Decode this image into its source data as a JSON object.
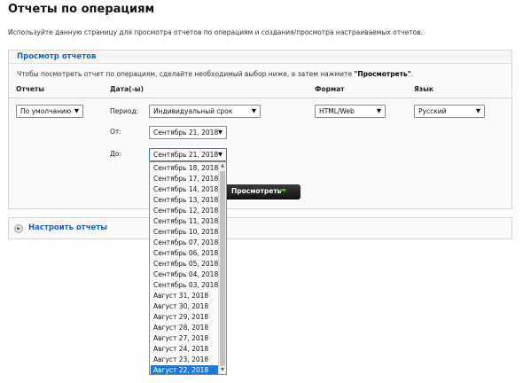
{
  "page": {
    "title": "Отчеты по операциям",
    "description": "Используйте данную страницу для просмотра отчетов по операциям и создания/просмотра настраиваемых отчетов."
  },
  "viewer": {
    "title": "Просмотр отчетов",
    "instruction_prefix": "Чтобы посмотреть отчет по операциям, сделайте необходимый выбор ниже, а затем нажмите ",
    "instruction_action": "\"Просмотреть\"",
    "instruction_suffix": ".",
    "columns": {
      "reports": "Отчеты",
      "date": "Дата(-ы)",
      "format": "Формат",
      "language": "Язык"
    },
    "report_select": "По умолчанию",
    "period_label": "Период:",
    "period_select": "Индивидуальный срок",
    "from_label": "От:",
    "from_select": "Сентябрь 21, 2018",
    "to_label": "До:",
    "to_select": "Сентябрь 21, 2018",
    "format_select": "HTML/Web",
    "language_select": "Русский",
    "submit_label": "Просмотреть",
    "submit_icon": "arrow-right-icon"
  },
  "to_dropdown": {
    "options": [
      "Сентябрь 18, 2018",
      "Сентябрь 17, 2018",
      "Сентябрь 14, 2018",
      "Сентябрь 13, 2018",
      "Сентябрь 12, 2018",
      "Сентябрь 11, 2018",
      "Сентябрь 10, 2018",
      "Сентябрь 07, 2018",
      "Сентябрь 06, 2018",
      "Сентябрь 05, 2018",
      "Сентябрь 04, 2018",
      "Сентябрь 03, 2018",
      "Август 31, 2018",
      "Август 30, 2018",
      "Август 29, 2018",
      "Август 28, 2018",
      "Август 27, 2018",
      "Август 24, 2018",
      "Август 23, 2018",
      "Август 22, 2018"
    ],
    "selected": "Август 22, 2018"
  },
  "custom": {
    "label": "Настроить отчеты"
  },
  "colors": {
    "link": "#1f5fb4",
    "selected": "#1e78d6",
    "go_arrow": "#5ec61c"
  }
}
